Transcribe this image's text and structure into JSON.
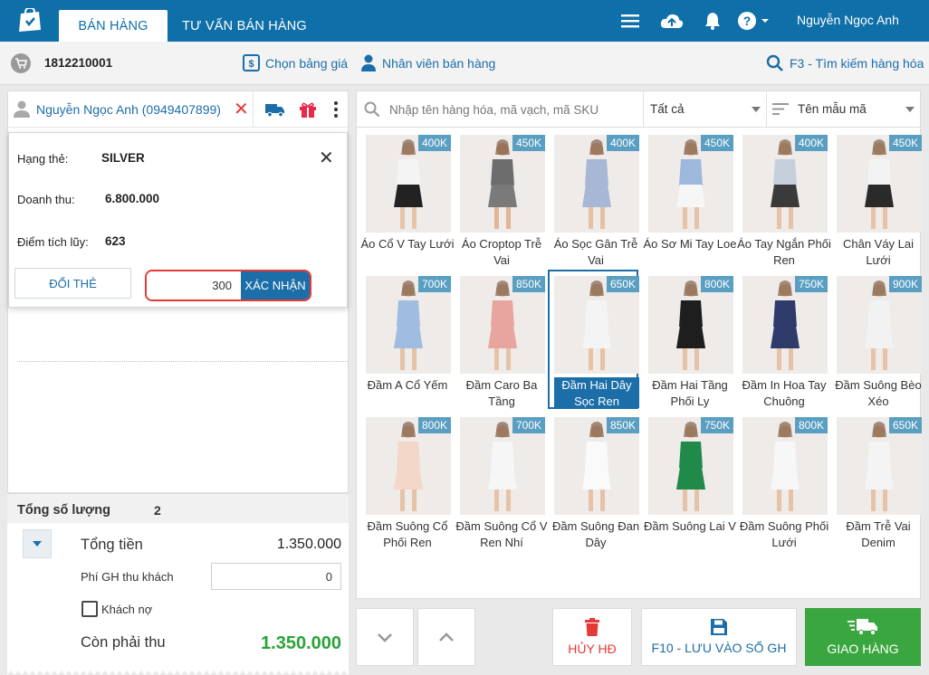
{
  "topbar": {
    "tabs": [
      {
        "label": "BÁN HÀNG"
      },
      {
        "label": "TƯ VẤN BÁN HÀNG"
      }
    ],
    "user_name": "Nguyễn Ngọc Anh"
  },
  "subbar": {
    "invoice_code": "1812210001",
    "price_list_label": "Chọn bảng giá",
    "staff_label": "Nhân viên bán hàng",
    "search_shortcut_label": "F3 - Tìm kiếm hàng hóa"
  },
  "customer": {
    "name": "Nguyễn Ngọc Anh (0949407899)"
  },
  "card_popup": {
    "tier_label": "Hạng thẻ:",
    "tier_value": "SILVER",
    "revenue_label": "Doanh thu:",
    "revenue_value": "6.800.000",
    "points_label": "Điểm tích lũy:",
    "points_value": "623",
    "change_card_label": "ĐỔI THẺ",
    "points_input_value": "300",
    "confirm_label": "XÁC NHẬN"
  },
  "totals": {
    "quantity_label": "Tổng số lượng",
    "quantity_value": "2",
    "total_label": "Tổng tiền",
    "total_value": "1.350.000",
    "shipping_label": "Phí GH thu khách",
    "shipping_value": "0",
    "debt_label": "Khách nợ",
    "remaining_label": "Còn phải thu",
    "remaining_value": "1.350.000"
  },
  "search": {
    "placeholder": "Nhập tên hàng hóa, mã vạch, mã SKU",
    "category_value": "Tất cả",
    "sort_value": "Tên mẫu mã"
  },
  "products": [
    {
      "price": "400K",
      "name": "Áo Cổ V Tay Lưới",
      "top": "#f4f4f4",
      "bottom": "#222222",
      "skin": "#e8c4a8",
      "bg": "#efebe8"
    },
    {
      "price": "450K",
      "name": "Áo Croptop Trễ Vai",
      "top": "#6d6d6d",
      "bottom": "#7a7a7a",
      "skin": "#e2b596",
      "bg": "#efebe8"
    },
    {
      "price": "400K",
      "name": "Áo Sọc Gân Trễ Vai",
      "top": "#a9b7d6",
      "bottom": "#a9b7d6",
      "skin": "#e6c0a3",
      "bg": "#efebe8"
    },
    {
      "price": "450K",
      "name": "Áo Sơ Mi Tay Loe",
      "top": "#9cb8dc",
      "bottom": "#f6f6f6",
      "skin": "#e6c2a6",
      "bg": "#efebe8"
    },
    {
      "price": "400K",
      "name": "Áo Tay Ngắn Phối Ren",
      "top": "#c5cfdb",
      "bottom": "#3a3a3a",
      "skin": "#e6c2a6",
      "bg": "#efebe8"
    },
    {
      "price": "450K",
      "name": "Chân Váy Lai Lưới",
      "top": "#f3f3f3",
      "bottom": "#2a2a2a",
      "skin": "#e6c2a6",
      "bg": "#efebe8"
    },
    {
      "price": "700K",
      "name": "Đầm A Cổ Yếm",
      "top": "#9fbde0",
      "bottom": "#9fbde0",
      "skin": "#e6c2a6",
      "bg": "#efebe8"
    },
    {
      "price": "850K",
      "name": "Đầm Caro Ba Tầng",
      "top": "#e8a5a0",
      "bottom": "#e8a5a0",
      "skin": "#e6c2a6",
      "bg": "#efebe8"
    },
    {
      "price": "650K",
      "name": "Đầm Hai Dây Sọc Ren",
      "top": "#f4f4f4",
      "bottom": "#f4f4f4",
      "skin": "#e6c2a6",
      "bg": "#efebe8"
    },
    {
      "price": "800K",
      "name": "Đầm Hai Tầng Phối Ly",
      "top": "#1e1e1e",
      "bottom": "#1e1e1e",
      "skin": "#e6c2a6",
      "bg": "#efebe8"
    },
    {
      "price": "750K",
      "name": "Đầm In Hoa Tay Chuông",
      "top": "#2e3a6a",
      "bottom": "#2e3a6a",
      "skin": "#e6c2a6",
      "bg": "#efebe8"
    },
    {
      "price": "900K",
      "name": "Đầm Suông Bèo Xéo",
      "top": "#f2f2f2",
      "bottom": "#f2f2f2",
      "skin": "#e6c2a6",
      "bg": "#efebe8"
    },
    {
      "price": "800K",
      "name": "Đầm Suông Cổ Phối Ren",
      "top": "#f3d7c9",
      "bottom": "#f3d7c9",
      "skin": "#e6c2a6",
      "bg": "#efebe8"
    },
    {
      "price": "700K",
      "name": "Đầm Suông Cổ V Ren Nhí",
      "top": "#f6f6f6",
      "bottom": "#f6f6f6",
      "skin": "#e6c2a6",
      "bg": "#efebe8"
    },
    {
      "price": "850K",
      "name": "Đầm Suông Đan Dây",
      "top": "#fafafa",
      "bottom": "#fafafa",
      "skin": "#e6c2a6",
      "bg": "#efebe8"
    },
    {
      "price": "750K",
      "name": "Đầm Suông Lai V",
      "top": "#1f8a4a",
      "bottom": "#1f8a4a",
      "skin": "#e6c2a6",
      "bg": "#efebe8"
    },
    {
      "price": "800K",
      "name": "Đầm Suông Phối Lưới",
      "top": "#f7f7f7",
      "bottom": "#f7f7f7",
      "skin": "#e6c2a6",
      "bg": "#efebe8"
    },
    {
      "price": "650K",
      "name": "Đầm Trễ Vai Denim",
      "top": "#f4f4f4",
      "bottom": "#f4f4f4",
      "skin": "#e6c2a6",
      "bg": "#efebe8"
    }
  ],
  "selected_product_index": 8,
  "actions": {
    "cancel_label": "HỦY HĐ",
    "save_label": "F10 - LƯU VÀO SỔ GH",
    "deliver_label": "GIAO HÀNG"
  },
  "colors": {
    "brand": "#0f6fa8",
    "danger": "#e53935",
    "success": "#2aa33a",
    "price_badge": "#5a9fc2"
  }
}
